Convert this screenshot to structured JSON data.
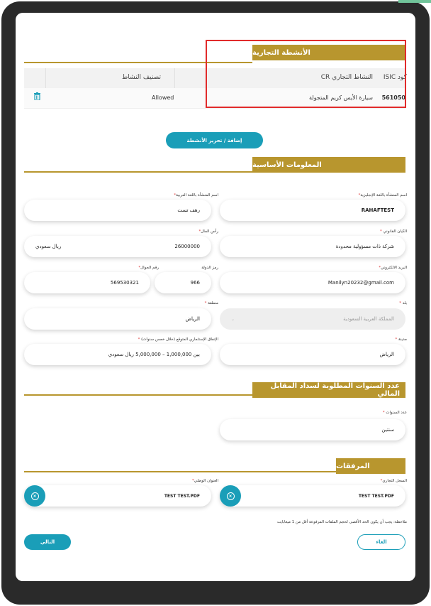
{
  "business": {
    "title": "الأنشطة التجارية",
    "columns": {
      "isic": "كود ISIC",
      "activity": "النشاط التجاري CR",
      "classification": "تصنيف النشاط"
    },
    "row": {
      "code": "561050",
      "activity": "سيارة الأيس كريم المتجولة",
      "classification": "Allowed"
    },
    "add_button": "إضافة / تحرير الأنشطة"
  },
  "basic": {
    "title": "المعلومات الأساسية",
    "name_en_label": "اسم المنشأة باللغة الإنجليزية",
    "name_en_value": "RAHAFTEST",
    "name_ar_label": "اسم المنشأة باللغة العربية",
    "name_ar_value": "رهف تست",
    "legal_label": "الكيان القانوني",
    "legal_value": "شركة ذات مسؤولية محدودة",
    "capital_label": "رأس المال",
    "capital_value": "26000000",
    "capital_currency": "ريال سعودي",
    "email_label": "البريد الالكتروني",
    "email_value": "Manilyn20232@gmail.com",
    "country_code_label": "رمز الدولة",
    "country_code_value": "966",
    "mobile_label": "رقم الجوال",
    "mobile_value": "569530321",
    "country_label": "بلد",
    "country_value": "المملكة العربية السعودية",
    "region_label": "منطقة",
    "region_value": "الرياض",
    "city_label": "مدينة",
    "city_value": "الرياض",
    "invest_label": "الإنفاق الإستثماري المتوقع (خلال خمس سنوات)",
    "invest_value": "بين 1,000,000 – 5,000,000 ريال سعودي"
  },
  "years": {
    "title": "عدد السنوات المطلوبة لسداد المقابل المالي",
    "label": "عدد السنوات",
    "value": "سنتين"
  },
  "attachments": {
    "title": "المرفقات",
    "cr_label": "السجل التجاري",
    "cr_file": "TEST TEST.PDF",
    "address_label": "العنوان الوطني",
    "address_file": "TEST TEST.PDF",
    "note": "ملاحظة: يجب أن يكون الحد الأقصى لحجم الملفات المرفوعة أقل من 1 ميغابايت"
  },
  "footer": {
    "cancel": "الغاء",
    "next": "التالي"
  },
  "colors": {
    "gold": "#b8962e",
    "teal": "#1a9eb8",
    "highlight": "#e12b2b"
  },
  "icons": {
    "delete": "trash-icon",
    "remove_file": "close-circle-icon"
  }
}
